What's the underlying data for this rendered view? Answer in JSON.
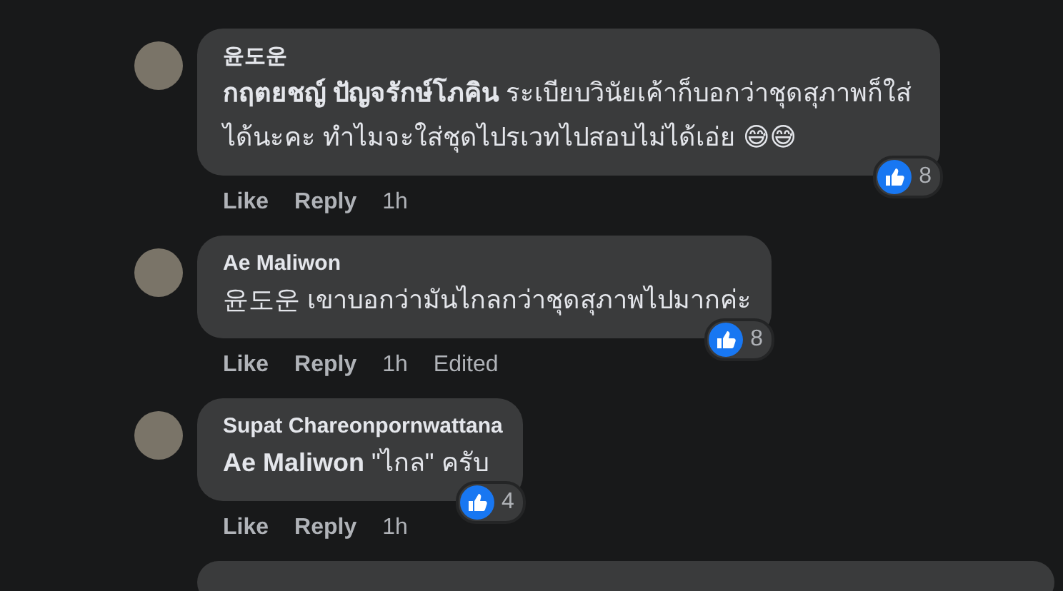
{
  "comments": [
    {
      "author": "윤도운",
      "text": "**กฤตยชญ์ ปัญจรักษ์โภคิน** ระเบียบวินัยเค้าก็บอกว่าชุดสุภาพก็ใส่ได้นะคะ ทำไมจะใส่ชุดไปรเวทไปสอบไม่ได้เอ่ย 😅😅",
      "reactions": "8",
      "actions": [
        {
          "kind": "link",
          "label": "Like"
        },
        {
          "kind": "link",
          "label": "Reply"
        },
        {
          "kind": "meta",
          "label": "1h"
        }
      ]
    },
    {
      "author": "Ae Maliwon",
      "text": "윤도운 เขาบอกว่ามันไกลกว่าชุดสุภาพไปมากค่ะ",
      "reactions": "8",
      "actions": [
        {
          "kind": "link",
          "label": "Like"
        },
        {
          "kind": "link",
          "label": "Reply"
        },
        {
          "kind": "meta",
          "label": "1h"
        },
        {
          "kind": "meta",
          "label": "Edited"
        }
      ]
    },
    {
      "author": "Supat Chareonpornwattana",
      "text": "**Ae Maliwon** \"ไกล\" ครับ",
      "reactions": "4",
      "actions": [
        {
          "kind": "link",
          "label": "Like"
        },
        {
          "kind": "link",
          "label": "Reply"
        },
        {
          "kind": "meta",
          "label": "1h"
        }
      ]
    }
  ]
}
